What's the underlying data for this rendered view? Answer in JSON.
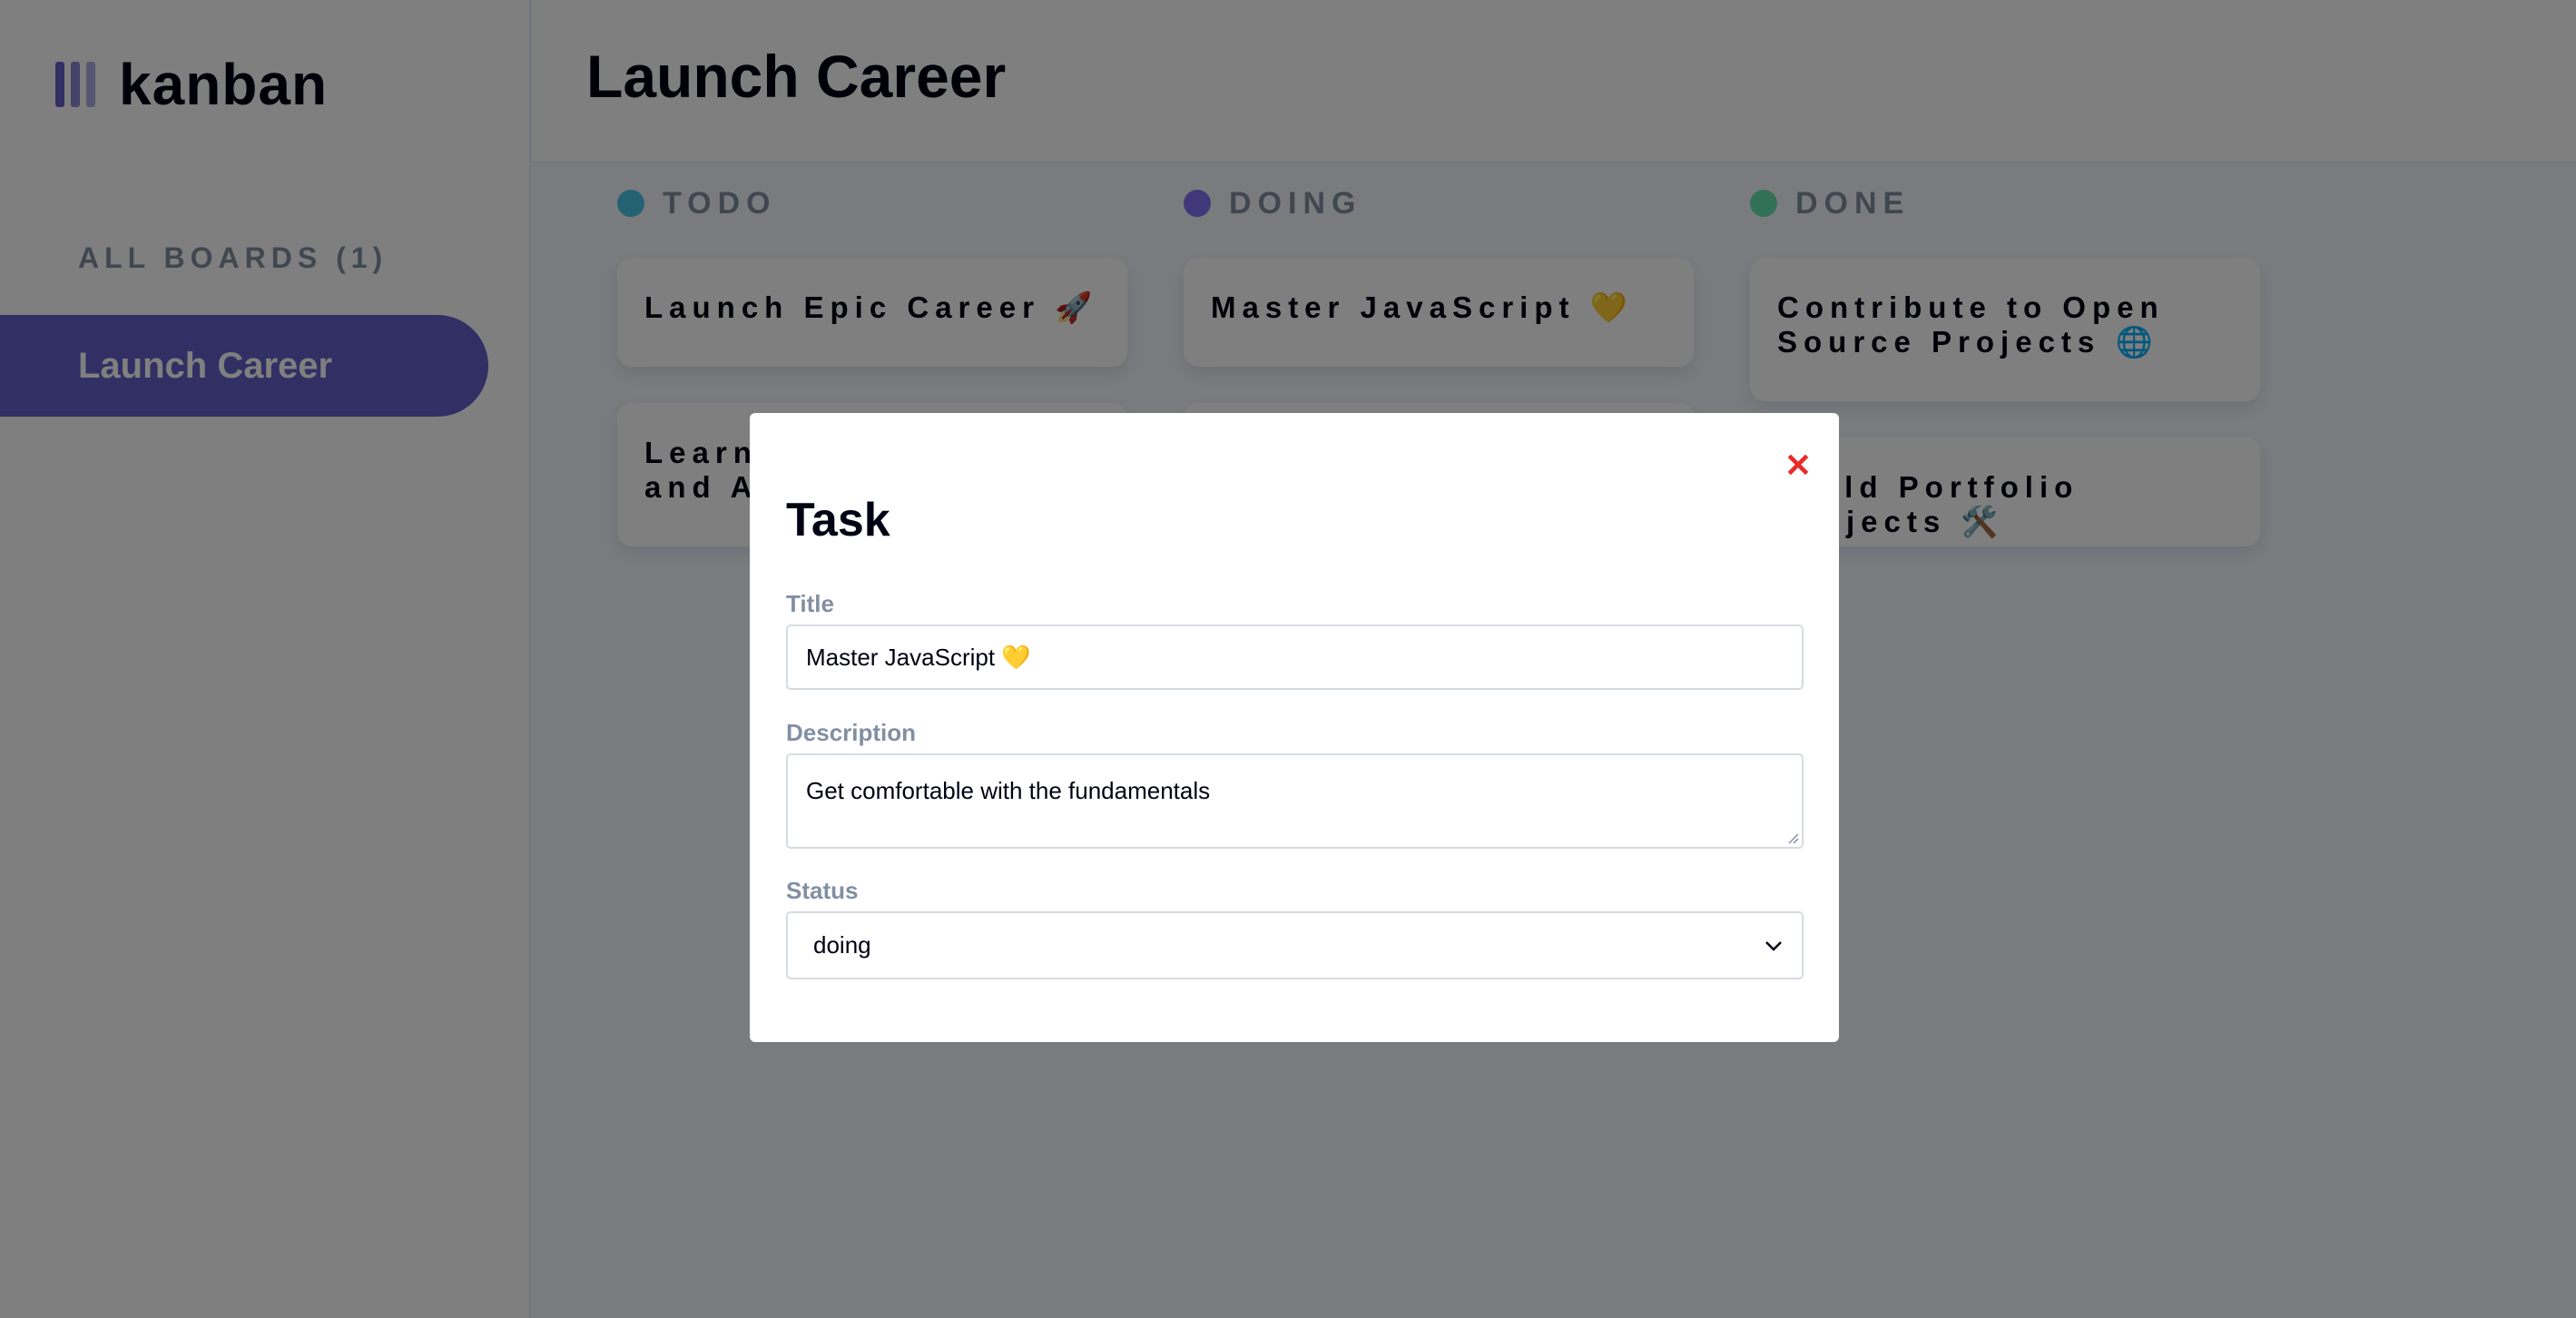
{
  "app": {
    "name": "kanban"
  },
  "sidebar": {
    "heading": "ALL BOARDS (1)",
    "boards": [
      "Launch Career"
    ]
  },
  "header": {
    "title": "Launch Career"
  },
  "columns": [
    {
      "name": "TODO",
      "color": "#49c4e5",
      "cards": [
        "Launch Epic Career 🚀",
        "Learn Data Structures and Algorithms 📚"
      ]
    },
    {
      "name": "DOING",
      "color": "#8471f2",
      "cards": [
        "Master JavaScript 💛",
        ""
      ]
    },
    {
      "name": "DONE",
      "color": "#67e2ae",
      "cards": [
        "Contribute to Open Source Projects 🌐",
        "Build Portfolio Projects 🛠️"
      ]
    }
  ],
  "modal": {
    "title": "Task",
    "close_icon": "close-icon",
    "title_label": "Title",
    "title_value": "Master JavaScript 💛",
    "description_label": "Description",
    "description_value": "Get comfortable with the fundamentals",
    "status_label": "Status",
    "status_value": "doing"
  },
  "colors": {
    "accent": "#635fc7",
    "close": "#ea2a2a",
    "overlay": "rgba(0,0,0,0.5)"
  }
}
